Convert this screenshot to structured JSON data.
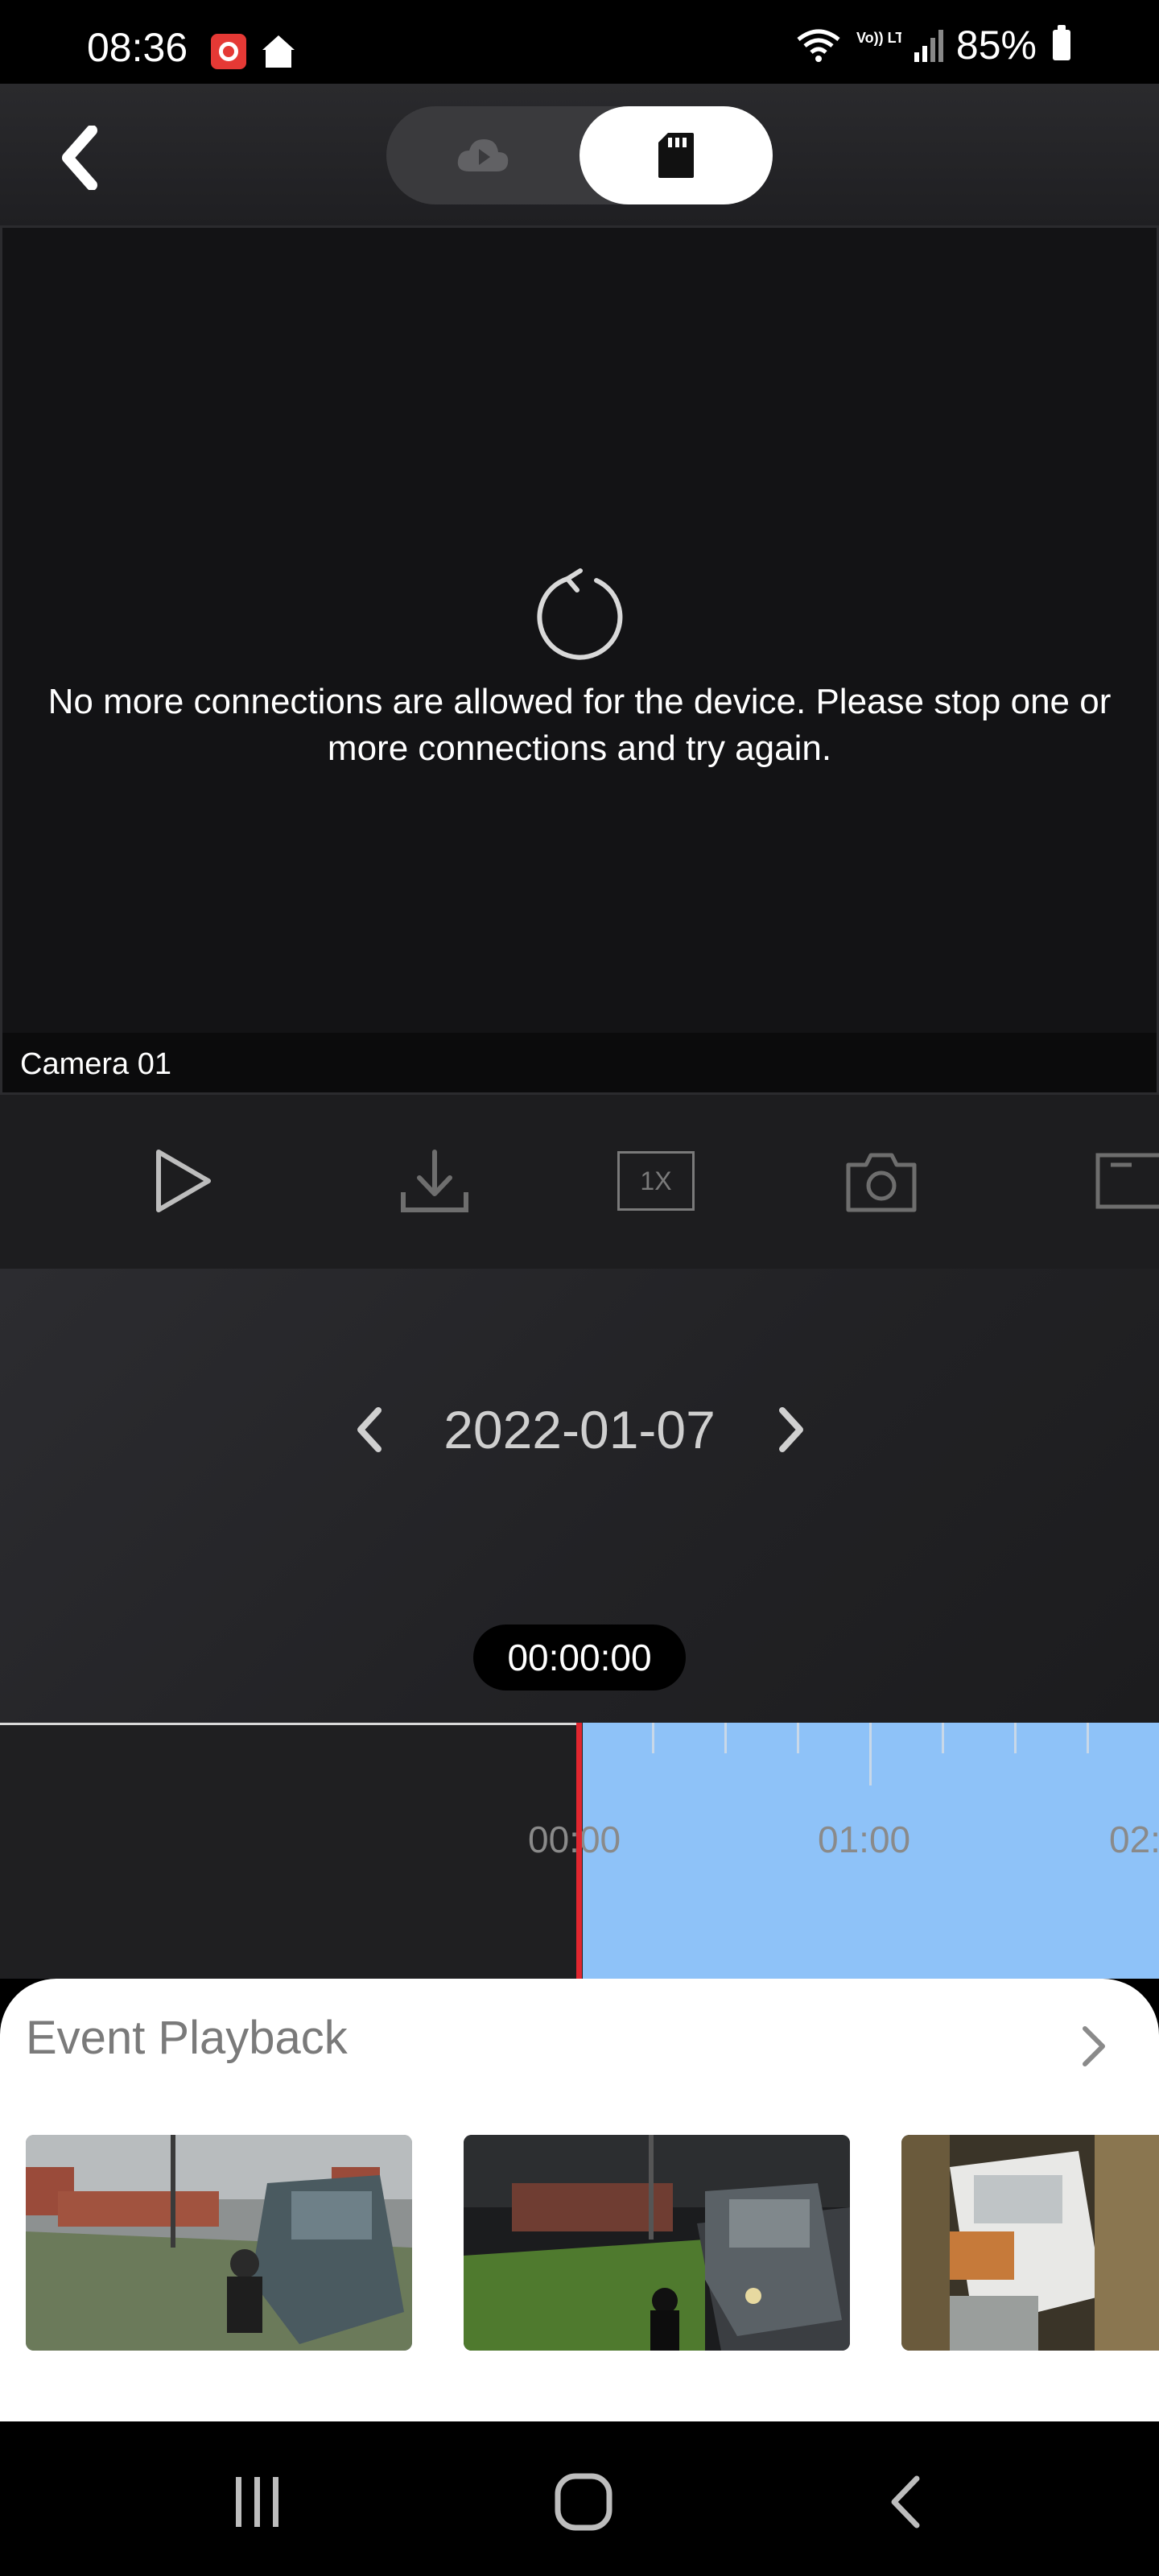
{
  "status_bar": {
    "time": "08:36",
    "battery": "85%",
    "network": "Vo)) LTE1",
    "icons": [
      "camera-app-icon",
      "home-icon",
      "wifi-icon",
      "signal-icon",
      "battery-icon"
    ]
  },
  "header": {
    "back_icon": "back-chevron-icon",
    "toggle": {
      "options": [
        {
          "name": "cloud",
          "icon": "cloud-play-icon",
          "selected": false
        },
        {
          "name": "sd-card",
          "icon": "sd-card-icon",
          "selected": true
        }
      ]
    }
  },
  "video": {
    "status_message": "No more connections are allowed for the device. Please stop one or more connections and try again.",
    "camera_name": "Camera 01",
    "refresh_icon": "refresh-icon"
  },
  "controls": {
    "items": [
      {
        "name": "play",
        "icon": "play-icon"
      },
      {
        "name": "download",
        "icon": "download-icon"
      },
      {
        "name": "speed",
        "label": "1X"
      },
      {
        "name": "snapshot",
        "icon": "camera-icon"
      },
      {
        "name": "fullscreen",
        "icon": "fullscreen-icon"
      }
    ]
  },
  "date_nav": {
    "date": "2022-01-07",
    "prev_icon": "chevron-left-icon",
    "next_icon": "chevron-right-icon",
    "current_time": "00:00:00"
  },
  "timeline": {
    "labels": [
      "00:00",
      "01:00",
      "02:"
    ],
    "recorded_color": "#8ec2f8",
    "playhead_color": "#e0262f"
  },
  "events": {
    "title": "Event Playback",
    "more_icon": "chevron-right-icon",
    "thumbnail_count": 3
  },
  "nav_bar": {
    "buttons": [
      "recents-icon",
      "home-icon",
      "back-icon"
    ]
  },
  "colors": {
    "background": "#000000",
    "panel": "#1d1d1f",
    "accent_blue": "#8ec2f8",
    "playhead_red": "#e0262f"
  }
}
